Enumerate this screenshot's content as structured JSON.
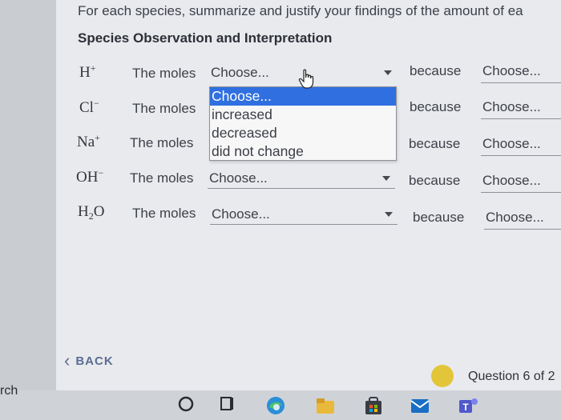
{
  "instruction": "For each species, summarize and justify your findings of the amount of ea",
  "table": {
    "header_species": "Species",
    "header_observation": "Observation and Interpretation",
    "rows": [
      {
        "symbol": "H",
        "sup": "+",
        "sub": "",
        "moles_label": "The moles",
        "value": "Choose...",
        "because": "because",
        "because_value": "Choose..."
      },
      {
        "symbol": "Cl",
        "sup": "−",
        "sub": "",
        "moles_label": "The moles",
        "value": "",
        "because": "because",
        "because_value": "Choose..."
      },
      {
        "symbol": "Na",
        "sup": "+",
        "sub": "",
        "moles_label": "The moles",
        "value": "",
        "because": "because",
        "because_value": "Choose..."
      },
      {
        "symbol": "OH",
        "sup": "−",
        "sub": "",
        "moles_label": "The moles",
        "value": "Choose...",
        "because": "because",
        "because_value": "Choose..."
      },
      {
        "symbol": "H",
        "sup": "",
        "sub": "2",
        "symbol_tail": "O",
        "moles_label": "The moles",
        "value": "Choose...",
        "because": "because",
        "because_value": "Choose..."
      }
    ]
  },
  "dropdown": {
    "options": [
      "Choose...",
      "increased",
      "decreased",
      "did not change"
    ],
    "selected_index": 0
  },
  "footer": {
    "back_label": "BACK",
    "question_label": "Question 6 of 2"
  },
  "taskbar": {
    "search_text": "rch",
    "icons": [
      "launcher-circle-icon",
      "files-icon",
      "edge-icon",
      "folder-icon",
      "store-icon",
      "mail-icon",
      "teams-icon"
    ]
  },
  "colors": {
    "selected_option": "#2f6fe0",
    "back_text": "#5a6e92",
    "question_dot": "#e3c53a"
  }
}
